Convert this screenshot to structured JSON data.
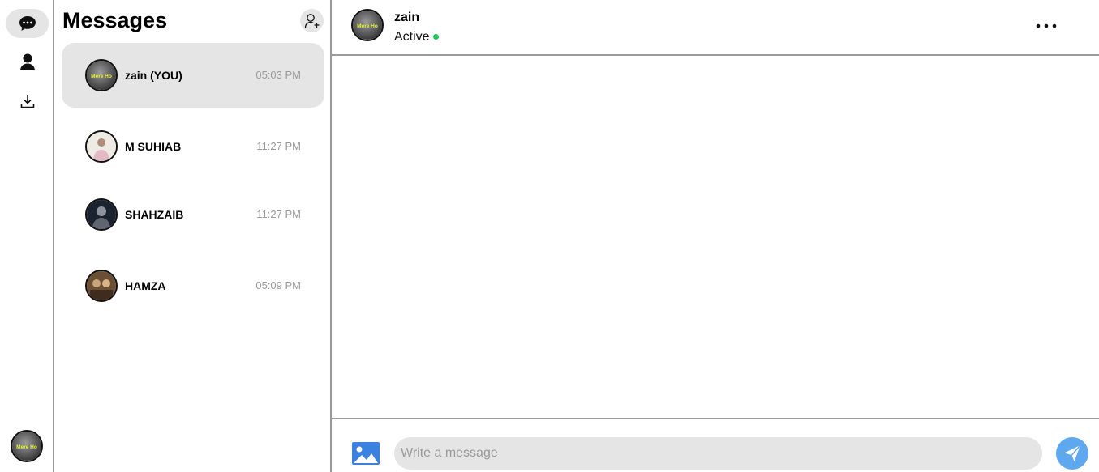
{
  "sidebar": {
    "nav": [
      {
        "icon": "chat-icon",
        "active": true
      },
      {
        "icon": "user-icon",
        "active": false
      },
      {
        "icon": "download-icon",
        "active": false
      }
    ],
    "avatar_badge_text": "Mere Ho"
  },
  "conversations_panel": {
    "title": "Messages",
    "new_chat_icon": "add-user-icon",
    "items": [
      {
        "name": "zain (YOU)",
        "time": "05:03 PM",
        "active": true
      },
      {
        "name": "M SUHIAB",
        "time": "11:27 PM",
        "active": false
      },
      {
        "name": "SHAHZAIB",
        "time": "11:27 PM",
        "active": false
      },
      {
        "name": "HAMZA",
        "time": "05:09 PM",
        "active": false
      }
    ]
  },
  "chat": {
    "contact_name": "zain",
    "status": "Active",
    "more_icon": "more-horizontal-icon",
    "composer": {
      "placeholder": "Write a message",
      "value": "",
      "image_icon": "image-icon",
      "send_icon": "send-icon"
    }
  },
  "colors": {
    "accent": "#5ea8f0",
    "image_icon": "#3b82e0",
    "online": "#22c55e",
    "active_bg": "#e5e5e5",
    "divider": "#9a9a9a"
  }
}
